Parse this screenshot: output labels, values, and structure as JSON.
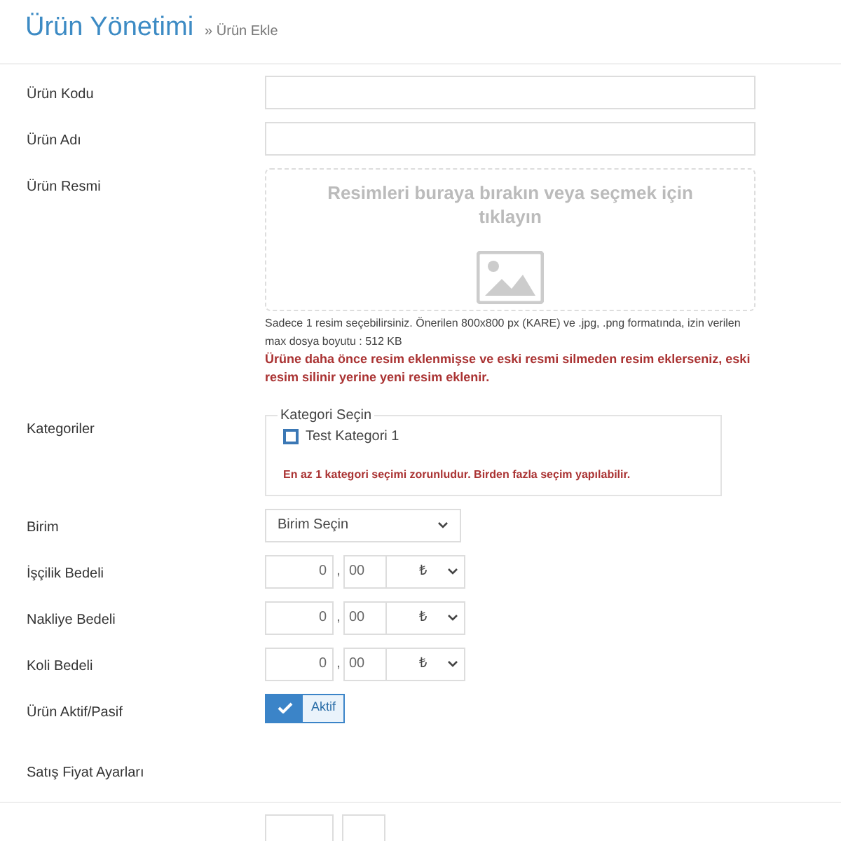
{
  "header": {
    "title": "Ürün Yönetimi",
    "breadcrumb": "» Ürün Ekle"
  },
  "fields": [
    {
      "kind": "text",
      "label": "Ürün Kodu"
    },
    {
      "kind": "text",
      "label": "Ürün Adı"
    },
    {
      "kind": "image",
      "label": "Ürün Resmi",
      "dropzone": "Resimleri buraya bırakın veya seçmek için tıklayın",
      "help": "Sadece 1 resim seçebilirsiniz. Önerilen 800x800 px (KARE) ve .jpg, .png formatında, izin verilen max dosya boyutu : 512 KB",
      "warning": "Ürüne daha önce resim eklenmişse ve eski resmi silmeden resim eklerseniz, eski resim silinir yerine yeni resim eklenir."
    },
    {
      "kind": "categories",
      "label": "Kategoriler",
      "legend": "Kategori Seçin",
      "options": [
        {
          "label": "Test Kategori 1",
          "checked": false
        }
      ],
      "warning": "En az 1 kategori seçimi zorunludur. Birden fazla seçim yapılabilir."
    },
    {
      "kind": "select",
      "label": "Birim",
      "value": "Birim Seçin"
    },
    {
      "kind": "money",
      "label": "İşçilik Bedeli",
      "whole": "0",
      "separator": ",",
      "fraction": "00",
      "currency": "₺"
    },
    {
      "kind": "money",
      "label": "Nakliye Bedeli",
      "whole": "0",
      "separator": ",",
      "fraction": "00",
      "currency": "₺"
    },
    {
      "kind": "money",
      "label": "Koli Bedeli",
      "whole": "0",
      "separator": ",",
      "fraction": "00",
      "currency": "₺"
    },
    {
      "kind": "toggle",
      "label": "Ürün Aktif/Pasif",
      "on": true,
      "text": "Aktif"
    }
  ],
  "section": {
    "title": "Satış Fiyat Ayarları"
  }
}
